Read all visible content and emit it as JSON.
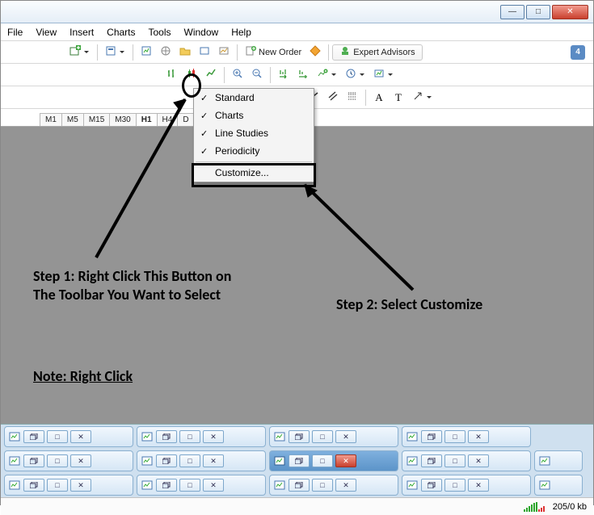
{
  "window": {
    "min": "—",
    "max": "□",
    "close": "✕"
  },
  "menu": {
    "file": "File",
    "view": "View",
    "insert": "Insert",
    "charts": "Charts",
    "tools": "Tools",
    "window": "Window",
    "help": "Help"
  },
  "toolbar1": {
    "new_order": "New Order",
    "expert_advisors": "Expert Advisors",
    "notif_count": "4"
  },
  "timeframes": {
    "m1": "M1",
    "m5": "M5",
    "m15": "M15",
    "m30": "M30",
    "h1": "H1",
    "h4": "H4",
    "d1": "D"
  },
  "context_menu": {
    "standard": "Standard",
    "charts": "Charts",
    "line_studies": "Line Studies",
    "periodicity": "Periodicity",
    "customize": "Customize..."
  },
  "annotations": {
    "step1": "Step 1: Right Click This Button on The Toolbar You Want to Select",
    "step2": "Step 2: Select Customize",
    "note": "Note: Right Click"
  },
  "status": {
    "traffic": "205/0 kb"
  }
}
